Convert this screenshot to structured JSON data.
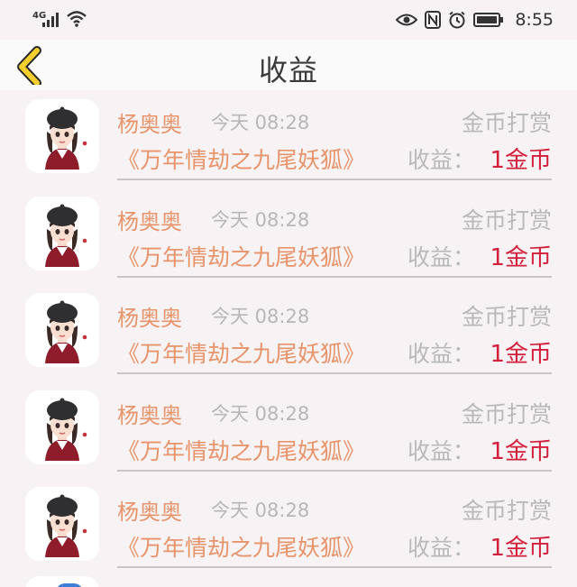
{
  "status_bar": {
    "network": "4G",
    "time": "8:55",
    "icons": [
      "signal-icon",
      "wifi-icon",
      "eye-icon",
      "nfc-icon",
      "alarm-icon",
      "battery-icon"
    ]
  },
  "header": {
    "title": "收益",
    "back_icon": "chevron-left-icon",
    "back_color": "#f5cf2e"
  },
  "colors": {
    "name": "#e8946a",
    "amount": "#d21f3c",
    "muted": "#b9b9b9"
  },
  "records": [
    {
      "name": "杨奥奥",
      "time": "今天 08:28",
      "type": "金币打赏",
      "book": "《万年情劫之九尾妖狐》",
      "earn_label": "收益：",
      "earn_value": "1金币"
    },
    {
      "name": "杨奥奥",
      "time": "今天 08:28",
      "type": "金币打赏",
      "book": "《万年情劫之九尾妖狐》",
      "earn_label": "收益：",
      "earn_value": "1金币"
    },
    {
      "name": "杨奥奥",
      "time": "今天 08:28",
      "type": "金币打赏",
      "book": "《万年情劫之九尾妖狐》",
      "earn_label": "收益：",
      "earn_value": "1金币"
    },
    {
      "name": "杨奥奥",
      "time": "今天 08:28",
      "type": "金币打赏",
      "book": "《万年情劫之九尾妖狐》",
      "earn_label": "收益：",
      "earn_value": "1金币"
    },
    {
      "name": "杨奥奥",
      "time": "今天 08:28",
      "type": "金币打赏",
      "book": "《万年情劫之九尾妖狐》",
      "earn_label": "收益：",
      "earn_value": "1金币"
    }
  ]
}
